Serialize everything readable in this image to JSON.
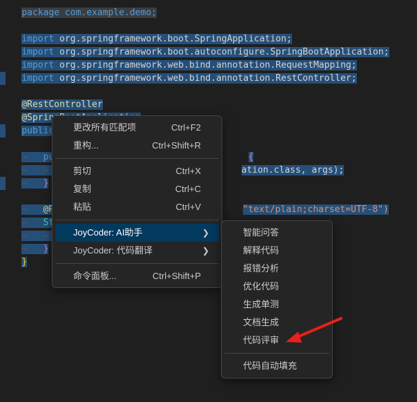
{
  "code": {
    "package_line": "package com.example.demo;",
    "import_keyword": "import",
    "imports": [
      "org.springframework.boot.SpringApplication;",
      "org.springframework.boot.autoconfigure.SpringBootApplication;",
      "org.springframework.web.bind.annotation.RequestMapping;",
      "org.springframework.web.bind.annotation.RestController;"
    ],
    "annotation_restcontroller": "@RestController",
    "annotation_springbootapp": "@SpringBootApplication",
    "class_decl_start": "public cla",
    "class_decl_end": "s {",
    "method_start": "public",
    "method_brace": "{",
    "method_body_start": "Sp",
    "method_body_end": "ation.class, args);",
    "close_brace": "}",
    "request_start": "@Reque",
    "request_string": "\"text/plain;charset=UTF-8\")",
    "string_start": "String",
    "return_start": "re",
    "close_brace_inner": "}",
    "close_brace_outer": "}"
  },
  "context_menu": {
    "items": [
      {
        "label": "更改所有匹配项",
        "shortcut": "Ctrl+F2"
      },
      {
        "label": "重构...",
        "shortcut": "Ctrl+Shift+R"
      },
      {
        "label": "剪切",
        "shortcut": "Ctrl+X"
      },
      {
        "label": "复制",
        "shortcut": "Ctrl+C"
      },
      {
        "label": "粘贴",
        "shortcut": "Ctrl+V"
      },
      {
        "label": "JoyCoder: AI助手",
        "shortcut": ""
      },
      {
        "label": "JoyCoder: 代码翻译",
        "shortcut": ""
      },
      {
        "label": "命令面板...",
        "shortcut": "Ctrl+Shift+P"
      }
    ]
  },
  "submenu": {
    "items": [
      {
        "label": "智能问答"
      },
      {
        "label": "解释代码"
      },
      {
        "label": "报错分析"
      },
      {
        "label": "优化代码"
      },
      {
        "label": "生成单测"
      },
      {
        "label": "文档生成"
      },
      {
        "label": "代码评审"
      },
      {
        "label": "代码自动填充"
      }
    ]
  },
  "colors": {
    "editor_bg": "#1f1f1f",
    "selection": "#264f78",
    "menu_bg": "#252526",
    "menu_active": "#04395e",
    "arrow": "#e8201a"
  }
}
